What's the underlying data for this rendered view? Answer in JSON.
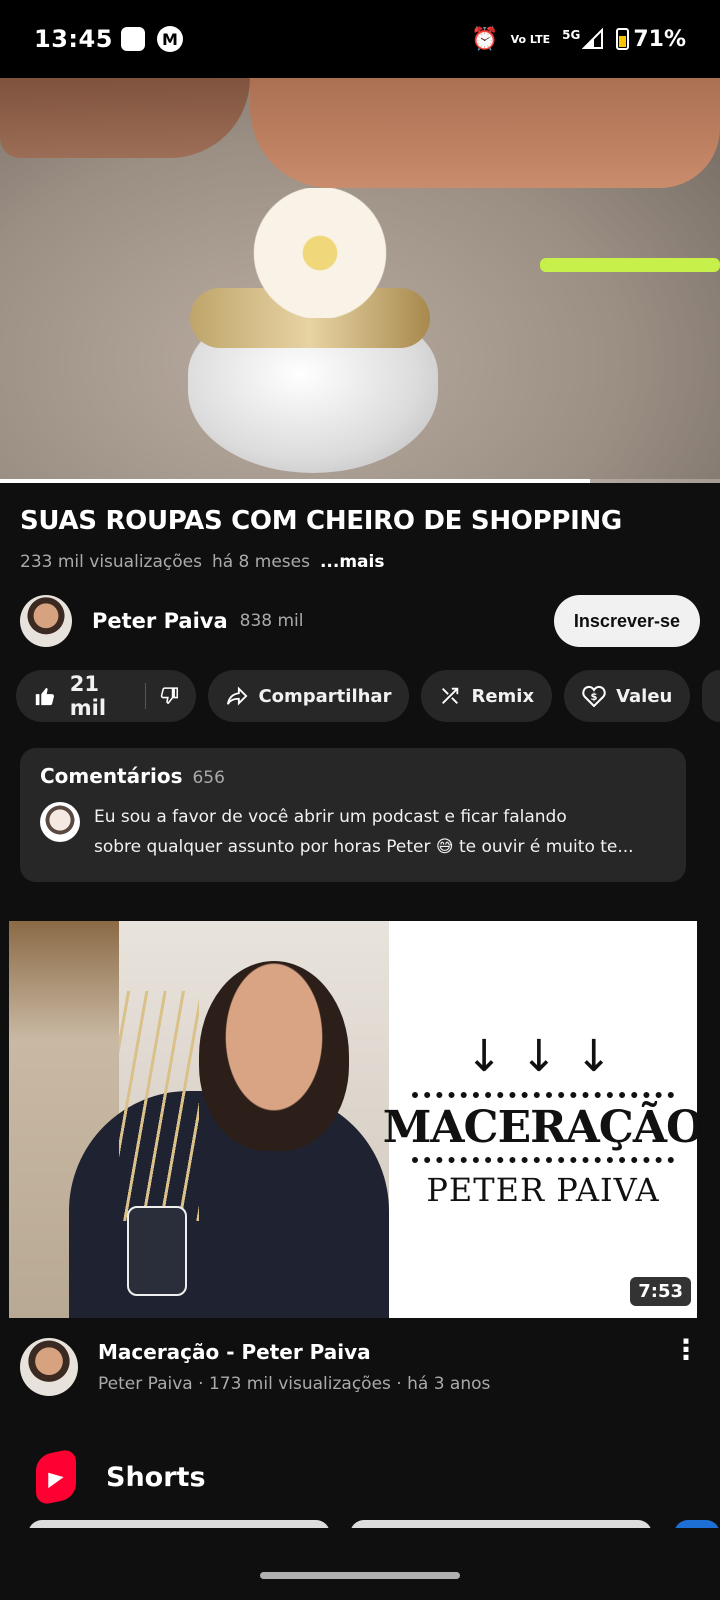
{
  "status_bar": {
    "time": "13:45",
    "network": "5G",
    "volte_label": "Vo LTE",
    "battery": "71%"
  },
  "player": {
    "progress_fraction": 0.82
  },
  "video": {
    "title": "SUAS ROUPAS COM CHEIRO DE SHOPPING",
    "views": "233 mil visualizações",
    "age": "há 8 meses",
    "more_label": "...mais"
  },
  "channel": {
    "name": "Peter Paiva",
    "subscribers": "838 mil",
    "subscribe_label": "Inscrever-se"
  },
  "actions": {
    "likes": "21 mil",
    "share_label": "Compartilhar",
    "remix_label": "Remix",
    "thanks_label": "Valeu"
  },
  "comments": {
    "title": "Comentários",
    "count": "656",
    "top_comment_line1": "Eu sou a favor de você abrir um podcast e ficar falando",
    "top_comment_line2": "sobre qualquer assunto por horas Peter 😅 te ouvir é muito te..."
  },
  "next_video": {
    "thumb_title": "MACERAÇÃO",
    "thumb_subtitle": "PETER PAIVA",
    "thumb_arrows": "↓↓↓",
    "duration": "7:53",
    "title": "Maceração - Peter Paiva",
    "meta": "Peter Paiva · 173 mil visualizações · há 3 anos"
  },
  "shorts": {
    "title": "Shorts"
  },
  "colors": {
    "background": "#0f0f0f",
    "chip": "#272727",
    "secondary_text": "#aaaaaa",
    "shorts_red": "#ff0033"
  }
}
